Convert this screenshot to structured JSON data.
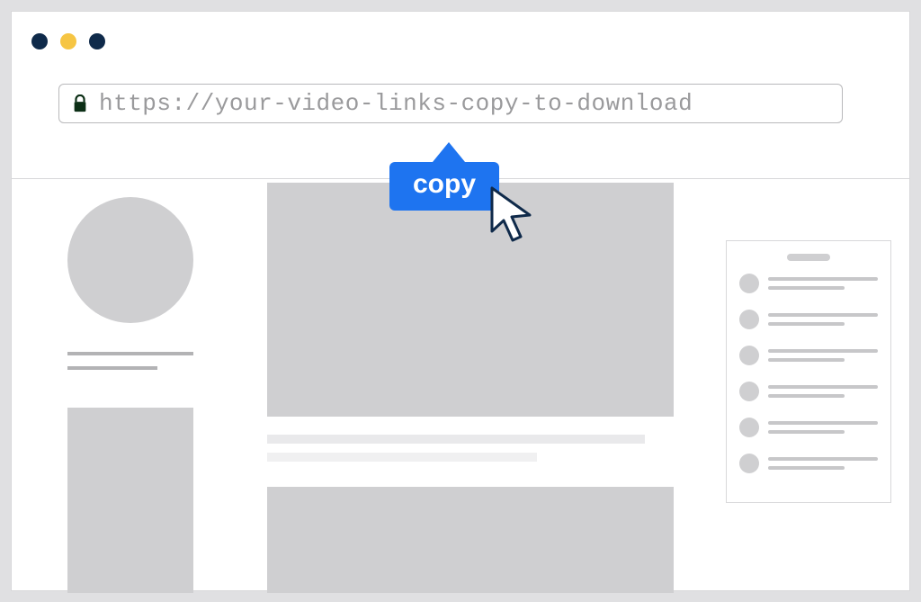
{
  "addressBar": {
    "url": "https://your-video-links-copy-to-download"
  },
  "tooltip": {
    "label": "copy"
  },
  "sidebar": {
    "item_count": 6
  }
}
